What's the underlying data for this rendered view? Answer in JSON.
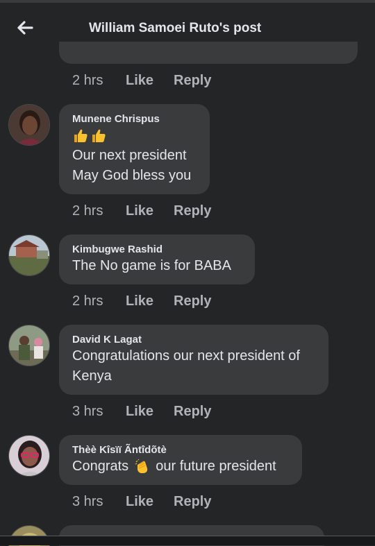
{
  "header": {
    "title": "William Samoei Ruto's post"
  },
  "previous_comment": {
    "time": "2 hrs",
    "like_label": "Like",
    "reply_label": "Reply"
  },
  "comments": [
    {
      "author": "Munene Chrispus",
      "emoji": "👍👍",
      "lines": [
        "Our next president",
        "May God bless you"
      ],
      "time": "2 hrs",
      "like_label": "Like",
      "reply_label": "Reply"
    },
    {
      "author": "Kimbugwe Rashid",
      "lines": [
        "The No game is for BABA"
      ],
      "time": "2 hrs",
      "like_label": "Like",
      "reply_label": "Reply"
    },
    {
      "author": "David K Lagat",
      "lines": [
        "Congratulations our next president of",
        "Kenya"
      ],
      "time": "3 hrs",
      "like_label": "Like",
      "reply_label": "Reply"
    },
    {
      "author": "Thèè Kîsïï Ãntîdõtè",
      "text_before_emoji": "Congrats ",
      "emoji": "👏",
      "text_after_emoji": " our future president",
      "time": "3 hrs",
      "like_label": "Like",
      "reply_label": "Reply"
    }
  ],
  "icons": {
    "back": "back-arrow-icon"
  },
  "colors": {
    "background": "#242526",
    "bubble": "#3a3b3c",
    "primary_text": "#e4e6eb",
    "secondary_text": "#b0b3b8"
  }
}
